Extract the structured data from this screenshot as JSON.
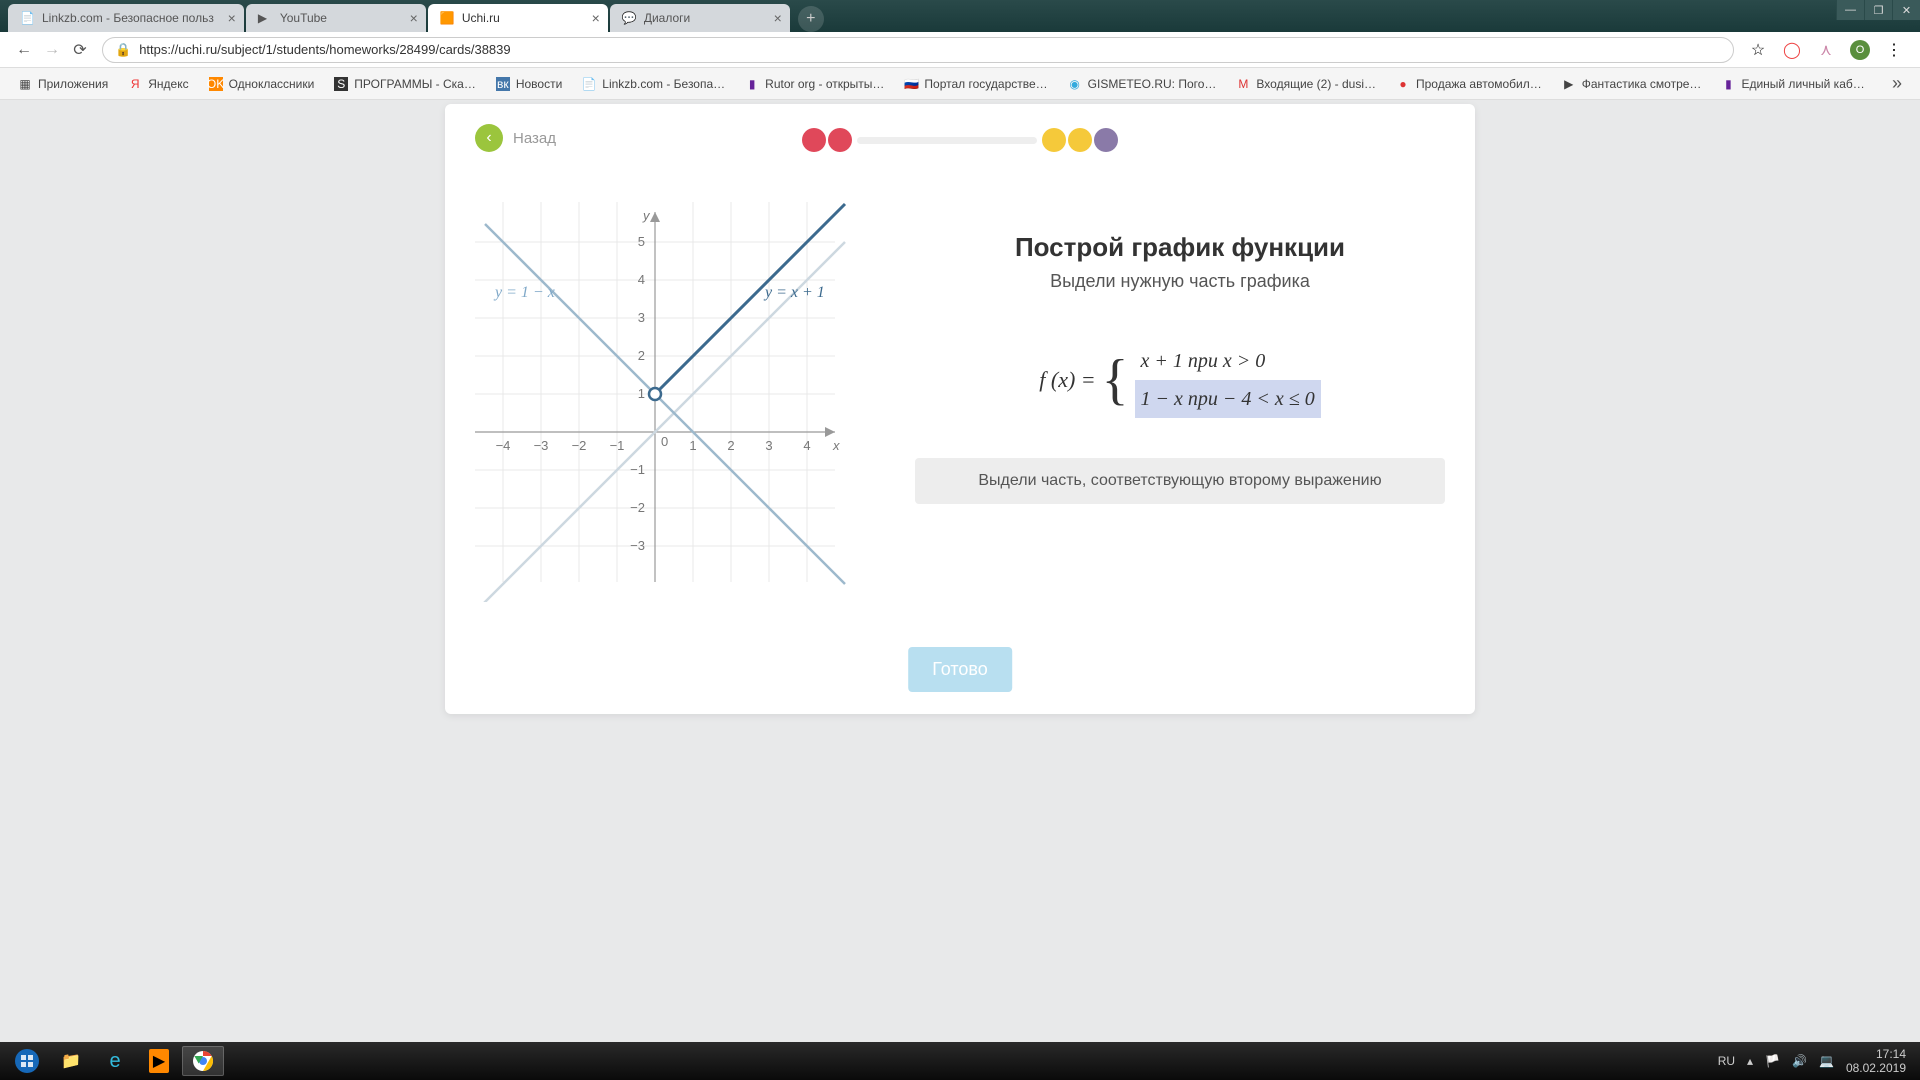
{
  "window": {
    "minimize": "—",
    "maximize": "❐",
    "close": "✕"
  },
  "tabs": [
    {
      "title": "Linkzb.com - Безопасное польз",
      "active": false
    },
    {
      "title": "YouTube",
      "active": false
    },
    {
      "title": "Uchi.ru",
      "active": true
    },
    {
      "title": "Диалоги",
      "active": false
    }
  ],
  "url": "https://uchi.ru/subject/1/students/homeworks/28499/cards/38839",
  "bookmarks": [
    "Приложения",
    "Яндекс",
    "Одноклассники",
    "ПРОГРАММЫ - Ска…",
    "Новости",
    "Linkzb.com - Безопа…",
    "Rutor org - открыты…",
    "Портал государстве…",
    "GISMETEO.RU: Пого…",
    "Входящие (2) - dusi…",
    "Продажа автомобил…",
    "Фантастика смотре…",
    "Единый личный каб…"
  ],
  "back_label": "Назад",
  "graph": {
    "y_axis": "y",
    "x_axis": "x",
    "label1": "y = 1 − x",
    "label2": "y = x + 1",
    "x_ticks": [
      "−4",
      "−3",
      "−2",
      "−1",
      "0",
      "1",
      "2",
      "3",
      "4"
    ],
    "y_ticks_pos": [
      "1",
      "2",
      "3",
      "4",
      "5"
    ],
    "y_ticks_neg": [
      "−1",
      "−2",
      "−3"
    ]
  },
  "panel": {
    "title": "Построй график функции",
    "subtitle": "Выдели нужную часть графика",
    "fx": "f (x) =",
    "case1": "x + 1 при x > 0",
    "case2": "1 − x при − 4 < x ≤ 0",
    "hint": "Выдели часть, соответствующую второму выражению"
  },
  "done": "Готово",
  "tray": {
    "lang": "RU",
    "time": "17:14",
    "date": "08.02.2019"
  },
  "chart_data": {
    "type": "line",
    "title": "Построй график функции",
    "xlabel": "x",
    "ylabel": "y",
    "xlim": [
      -5,
      5
    ],
    "ylim": [
      -4,
      6
    ],
    "series": [
      {
        "name": "y = 1 − x",
        "x": [
          -5,
          5
        ],
        "y": [
          6,
          -4
        ],
        "style": "guide"
      },
      {
        "name": "y = x + 1",
        "x": [
          -5,
          5
        ],
        "y": [
          -4,
          6
        ],
        "style": "guide"
      },
      {
        "name": "selected y = x + 1 (x > 0)",
        "x": [
          0,
          5
        ],
        "y": [
          1,
          6
        ],
        "style": "highlight",
        "open_point_at": [
          0,
          1
        ]
      }
    ],
    "piecewise": [
      {
        "expr": "x + 1",
        "domain": "x > 0"
      },
      {
        "expr": "1 − x",
        "domain": "−4 < x ≤ 0"
      }
    ]
  }
}
